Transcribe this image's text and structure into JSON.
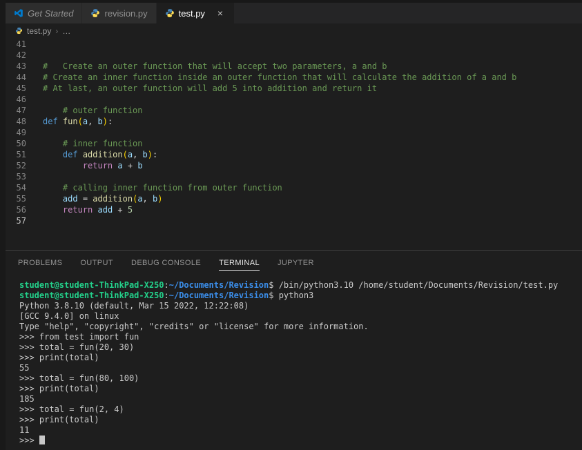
{
  "palette": {
    "comment": "#6a9955",
    "keyword": "#569cd6",
    "control": "#c586c0",
    "func": "#dcdcaa",
    "variable": "#9cdcfe",
    "number": "#b5cea8",
    "fg": "#d4d4d4",
    "bracket": "#ffd700",
    "term_green": "#23d18b",
    "term_blue": "#3b8eea",
    "term_fg": "#cccccc",
    "cursor": "#c8c8c8",
    "accent": "#007acc"
  },
  "tabs": [
    {
      "label": "Get Started",
      "icon": "vscode-logo-icon",
      "active": false
    },
    {
      "label": "revision.py",
      "icon": "python-icon",
      "active": false
    },
    {
      "label": "test.py",
      "icon": "python-icon",
      "active": true,
      "close_glyph": "×"
    }
  ],
  "breadcrumb": {
    "file": "test.py",
    "separator": "›",
    "ellipsis": "…"
  },
  "editor": {
    "lines": [
      {
        "num": 41,
        "segments": []
      },
      {
        "num": 42,
        "segments": []
      },
      {
        "num": 43,
        "segments": [
          {
            "t": "#   Create an outer function that will accept two parameters, a and b",
            "c": "comment"
          }
        ]
      },
      {
        "num": 44,
        "segments": [
          {
            "t": "# Create an inner function inside an outer function that will calculate the addition of a and b",
            "c": "comment"
          }
        ]
      },
      {
        "num": 45,
        "segments": [
          {
            "t": "# At last, an outer function will add 5 into addition and return it",
            "c": "comment"
          }
        ]
      },
      {
        "num": 46,
        "segments": []
      },
      {
        "num": 47,
        "segments": [
          {
            "t": "    # outer function",
            "c": "comment"
          }
        ]
      },
      {
        "num": 48,
        "segments": [
          {
            "t": "def",
            "c": "keyword"
          },
          {
            "t": " ",
            "c": "fg"
          },
          {
            "t": "fun",
            "c": "func"
          },
          {
            "t": "(",
            "c": "bracket"
          },
          {
            "t": "a",
            "c": "variable"
          },
          {
            "t": ", ",
            "c": "fg"
          },
          {
            "t": "b",
            "c": "variable"
          },
          {
            "t": ")",
            "c": "bracket"
          },
          {
            "t": ":",
            "c": "fg"
          }
        ]
      },
      {
        "num": 49,
        "segments": []
      },
      {
        "num": 50,
        "segments": [
          {
            "t": "    # inner function",
            "c": "comment"
          }
        ]
      },
      {
        "num": 51,
        "segments": [
          {
            "t": "    ",
            "c": "fg"
          },
          {
            "t": "def",
            "c": "keyword"
          },
          {
            "t": " ",
            "c": "fg"
          },
          {
            "t": "addition",
            "c": "func"
          },
          {
            "t": "(",
            "c": "bracket"
          },
          {
            "t": "a",
            "c": "variable"
          },
          {
            "t": ", ",
            "c": "fg"
          },
          {
            "t": "b",
            "c": "variable"
          },
          {
            "t": ")",
            "c": "bracket"
          },
          {
            "t": ":",
            "c": "fg"
          }
        ]
      },
      {
        "num": 52,
        "segments": [
          {
            "t": "        ",
            "c": "fg"
          },
          {
            "t": "return",
            "c": "control"
          },
          {
            "t": " ",
            "c": "fg"
          },
          {
            "t": "a",
            "c": "variable"
          },
          {
            "t": " + ",
            "c": "fg"
          },
          {
            "t": "b",
            "c": "variable"
          }
        ]
      },
      {
        "num": 53,
        "segments": []
      },
      {
        "num": 54,
        "segments": [
          {
            "t": "    # calling inner function from outer function",
            "c": "comment"
          }
        ]
      },
      {
        "num": 55,
        "segments": [
          {
            "t": "    ",
            "c": "fg"
          },
          {
            "t": "add",
            "c": "variable"
          },
          {
            "t": " = ",
            "c": "fg"
          },
          {
            "t": "addition",
            "c": "func"
          },
          {
            "t": "(",
            "c": "bracket"
          },
          {
            "t": "a",
            "c": "variable"
          },
          {
            "t": ", ",
            "c": "fg"
          },
          {
            "t": "b",
            "c": "variable"
          },
          {
            "t": ")",
            "c": "bracket"
          }
        ]
      },
      {
        "num": 56,
        "segments": [
          {
            "t": "    ",
            "c": "fg"
          },
          {
            "t": "return",
            "c": "control"
          },
          {
            "t": " ",
            "c": "fg"
          },
          {
            "t": "add",
            "c": "variable"
          },
          {
            "t": " + ",
            "c": "fg"
          },
          {
            "t": "5",
            "c": "number"
          }
        ]
      },
      {
        "num": 57,
        "segments": [],
        "active": true
      }
    ]
  },
  "panel": {
    "tabs": [
      {
        "label": "PROBLEMS",
        "active": false
      },
      {
        "label": "OUTPUT",
        "active": false
      },
      {
        "label": "DEBUG CONSOLE",
        "active": false
      },
      {
        "label": "TERMINAL",
        "active": true
      },
      {
        "label": "JUPYTER",
        "active": false
      }
    ],
    "terminal": {
      "lines": [
        {
          "segments": [
            {
              "t": "student@student-ThinkPad-X250",
              "c": "tgreen"
            },
            {
              "t": ":",
              "c": "tfg"
            },
            {
              "t": "~/Documents/Revision",
              "c": "tblue"
            },
            {
              "t": "$ ",
              "c": "tfg"
            },
            {
              "t": "/bin/python3.10 /home/student/Documents/Revision/test.py",
              "c": "tfg"
            }
          ]
        },
        {
          "segments": [
            {
              "t": "student@student-ThinkPad-X250",
              "c": "tgreen"
            },
            {
              "t": ":",
              "c": "tfg"
            },
            {
              "t": "~/Documents/Revision",
              "c": "tblue"
            },
            {
              "t": "$ ",
              "c": "tfg"
            },
            {
              "t": "python3",
              "c": "tfg"
            }
          ]
        },
        {
          "segments": [
            {
              "t": "Python 3.8.10 (default, Mar 15 2022, 12:22:08) ",
              "c": "tfg"
            }
          ]
        },
        {
          "segments": [
            {
              "t": "[GCC 9.4.0] on linux",
              "c": "tfg"
            }
          ]
        },
        {
          "segments": [
            {
              "t": "Type \"help\", \"copyright\", \"credits\" or \"license\" for more information.",
              "c": "tfg"
            }
          ]
        },
        {
          "segments": [
            {
              "t": ">>> from test import fun",
              "c": "tfg"
            }
          ]
        },
        {
          "segments": [
            {
              "t": ">>> total = fun(20, 30)",
              "c": "tfg"
            }
          ]
        },
        {
          "segments": [
            {
              "t": ">>> print(total)",
              "c": "tfg"
            }
          ]
        },
        {
          "segments": [
            {
              "t": "55",
              "c": "tfg"
            }
          ]
        },
        {
          "segments": [
            {
              "t": ">>> total = fun(80, 100)",
              "c": "tfg"
            }
          ]
        },
        {
          "segments": [
            {
              "t": ">>> print(total)",
              "c": "tfg"
            }
          ]
        },
        {
          "segments": [
            {
              "t": "185",
              "c": "tfg"
            }
          ]
        },
        {
          "segments": [
            {
              "t": ">>> total = fun(2, 4)",
              "c": "tfg"
            }
          ]
        },
        {
          "segments": [
            {
              "t": ">>> print(total)",
              "c": "tfg"
            }
          ]
        },
        {
          "segments": [
            {
              "t": "11",
              "c": "tfg"
            }
          ]
        },
        {
          "segments": [
            {
              "t": ">>> ",
              "c": "tfg"
            }
          ],
          "cursor": true
        }
      ]
    }
  }
}
